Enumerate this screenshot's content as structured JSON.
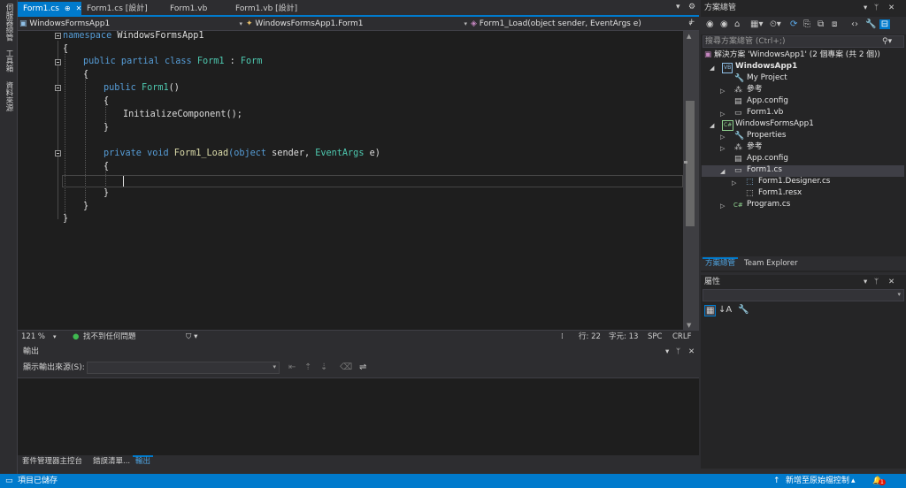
{
  "left_toolbar": [
    "伺服器總管",
    "工具箱",
    "資料來源"
  ],
  "tabs": [
    {
      "label": "Form1.cs",
      "active": true
    },
    {
      "label": "Form1.cs [設計]"
    },
    {
      "label": "Form1.vb"
    },
    {
      "label": "Form1.vb [設計]"
    }
  ],
  "nav": {
    "project": "WindowsFormsApp1",
    "class": "WindowsFormsApp1.Form1",
    "member": "Form1_Load(object sender, EventArgs e)"
  },
  "code": {
    "l1_kw": "namespace",
    "l1_name": "WindowsFormsApp1",
    "brace_open": "{",
    "brace_close": "}",
    "l3_kw": "public partial class",
    "l3_type": "Form1",
    "l3_sep": ":",
    "l3_base": "Form",
    "l5_kw": "public",
    "l5_name": "Form1",
    "l5_params": "()",
    "l7_call": "InitializeComponent();",
    "l10_kw": "private void",
    "l10_name": "Form1_Load",
    "l10_p1": "(object",
    "l10_p2": "sender,",
    "l10_p3": "EventArgs",
    "l10_p4": "e)"
  },
  "editor_status": {
    "zoom": "121 %",
    "issues": "找不到任何問題",
    "line": "行: 22",
    "col": "字元: 13",
    "spc": "SPC",
    "crlf": "CRLF"
  },
  "output": {
    "title": "輸出",
    "source_label": "顯示輸出來源(S):",
    "tabs": [
      "套件管理器主控台",
      "錯誤清單...",
      "輸出"
    ]
  },
  "solution_explorer": {
    "title": "方案總管",
    "search_placeholder": "搜尋方案總管 (Ctrl+;)",
    "solution": "解決方案 'WindowsApp1' (2 個專案 (共 2 個))",
    "items": [
      {
        "label": "WindowsApp1",
        "bold": true
      },
      {
        "label": "My Project"
      },
      {
        "label": "參考"
      },
      {
        "label": "App.config"
      },
      {
        "label": "Form1.vb"
      },
      {
        "label": "WindowsFormsApp1"
      },
      {
        "label": "Properties"
      },
      {
        "label": "參考"
      },
      {
        "label": "App.config"
      },
      {
        "label": "Form1.cs"
      },
      {
        "label": "Form1.Designer.cs"
      },
      {
        "label": "Form1.resx"
      },
      {
        "label": "Program.cs"
      }
    ],
    "tabs": [
      "方案總管",
      "Team Explorer"
    ]
  },
  "properties": {
    "title": "屬性"
  },
  "statusbar": {
    "left": "項目已儲存",
    "right": "新增至原始檔控制",
    "notif_count": "1"
  },
  "colors": {
    "accent": "#007acc",
    "keyword": "#569cd6",
    "type": "#4ec9b0"
  }
}
